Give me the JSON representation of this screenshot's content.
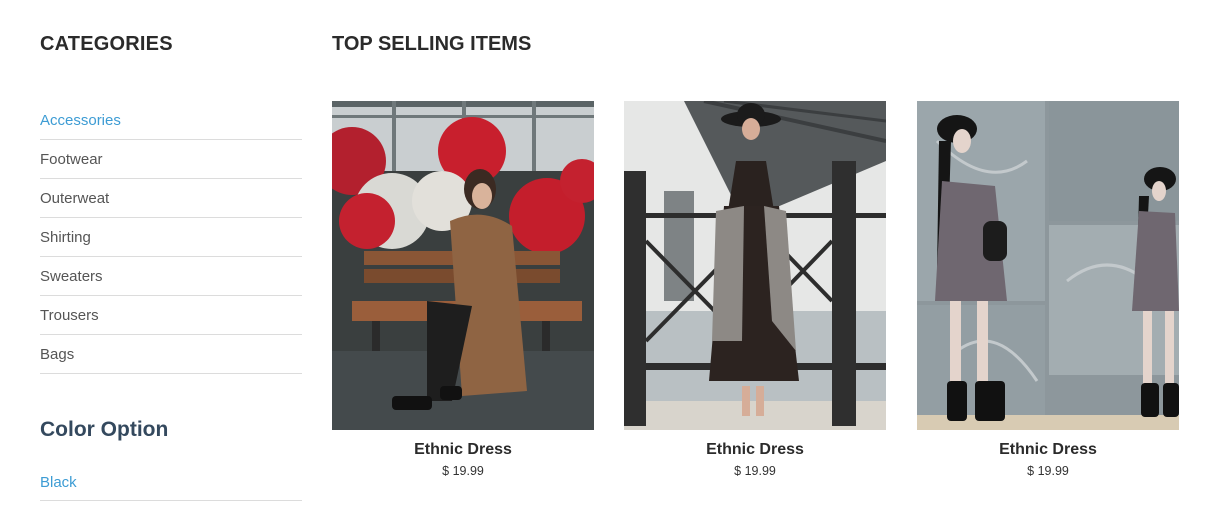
{
  "sidebar": {
    "categories_title": "CATEGORIES",
    "categories": [
      {
        "label": "Accessories",
        "active": true
      },
      {
        "label": "Footwear"
      },
      {
        "label": "Outerweat"
      },
      {
        "label": "Shirting"
      },
      {
        "label": "Sweaters"
      },
      {
        "label": "Trousers"
      },
      {
        "label": "Bags"
      }
    ],
    "color_title": "Color Option",
    "colors": [
      {
        "label": "Black"
      }
    ]
  },
  "main": {
    "title": "TOP SELLING ITEMS",
    "products": [
      {
        "name": "Ethnic Dress",
        "price": "$ 19.99",
        "image": "woman-in-brown-coat-on-bench-with-flowers-photo"
      },
      {
        "name": "Ethnic Dress",
        "price": "$ 19.99",
        "image": "woman-in-hat-and-black-dress-by-bridge-photo"
      },
      {
        "name": "Ethnic Dress",
        "price": "$ 19.99",
        "image": "woman-in-grey-dress-by-marble-wall-photo"
      }
    ]
  },
  "colors": {
    "accent": "#3d9cd4",
    "heading": "#2b2b2b",
    "divider": "#dcdcdc"
  }
}
